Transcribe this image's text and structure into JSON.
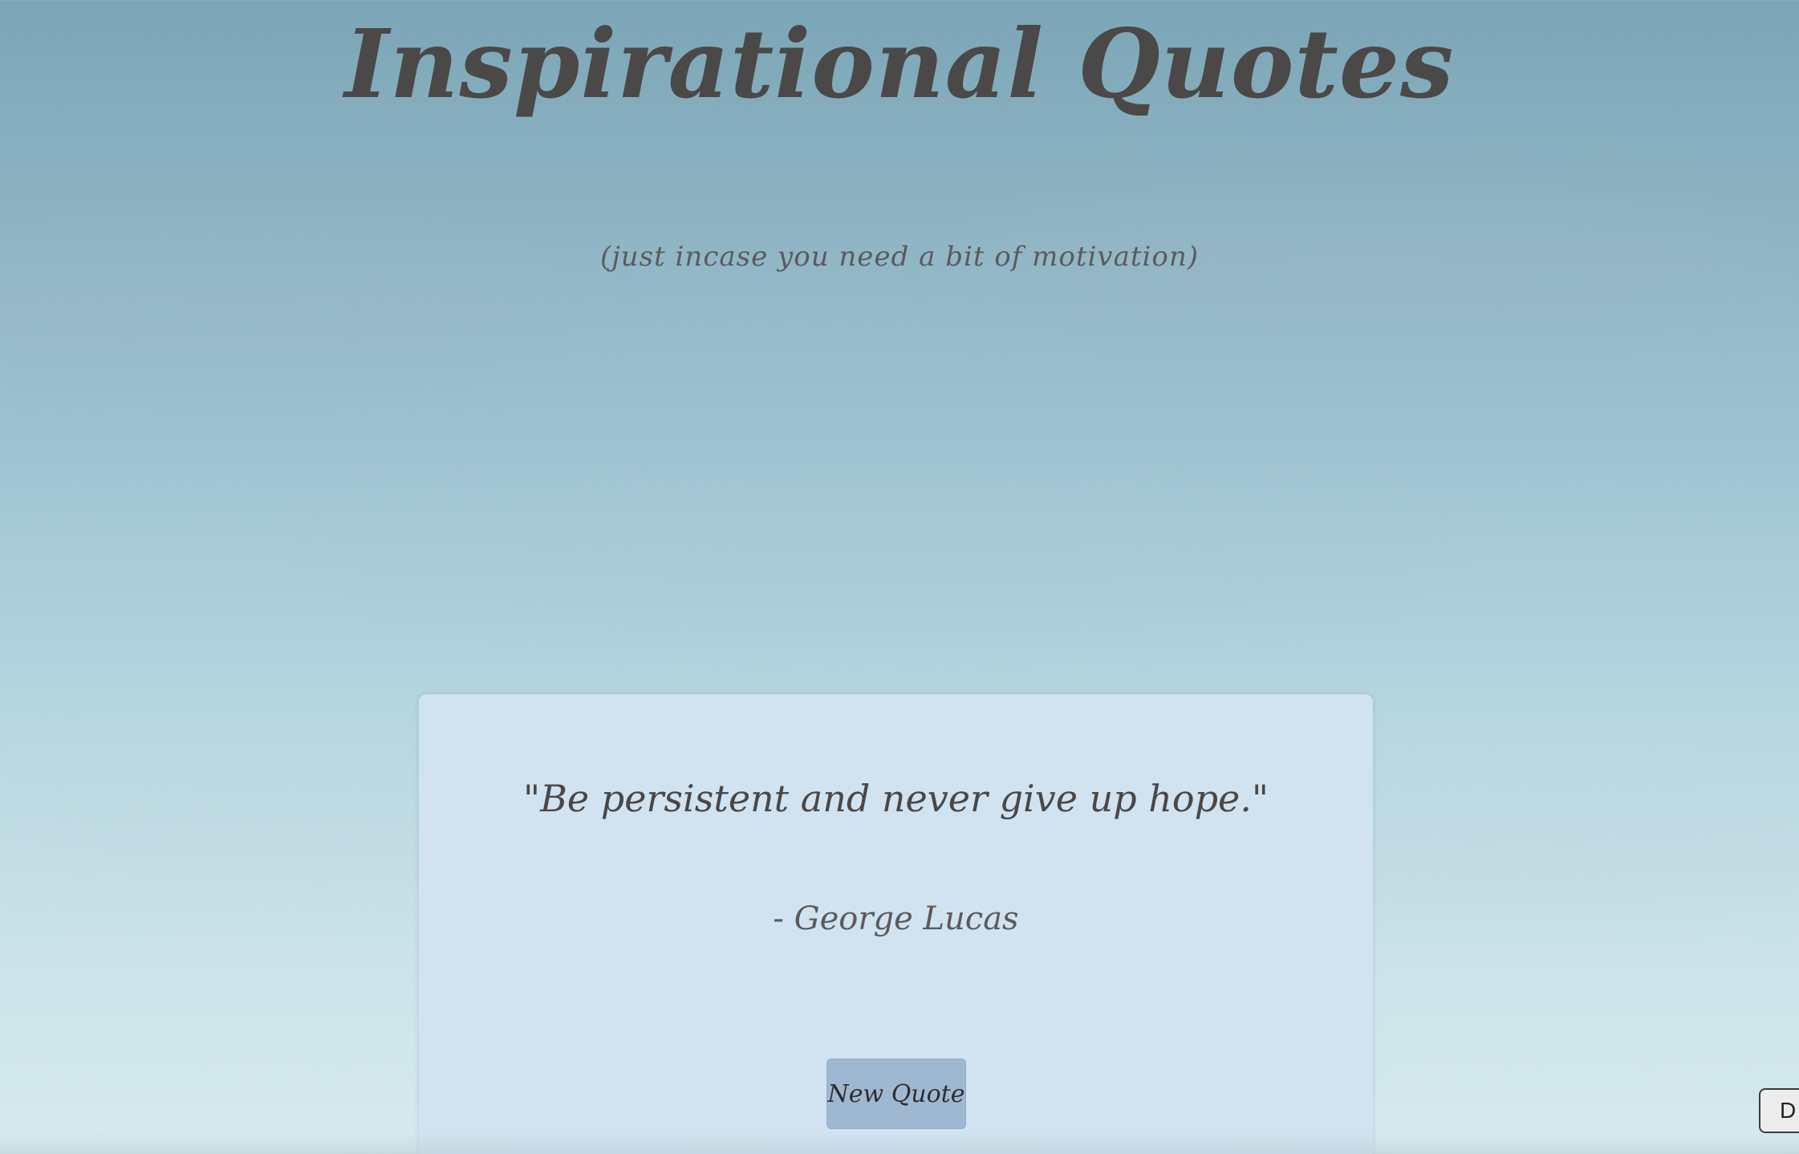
{
  "header": {
    "title": "Inspirational Quotes",
    "subtitle": "(just incase you need a bit of motivation)"
  },
  "quote_card": {
    "quote": "\"Be persistent and never give up hope.\"",
    "author": "- George Lucas",
    "button_label": "New Quote"
  },
  "corner_widget": {
    "label": "D"
  },
  "colors": {
    "sky_top": "#7ba6b7",
    "sky_bottom": "#d7eaee",
    "card_background": "#d1e3f0",
    "button_background": "#9fb8d2",
    "text": "#4b4848"
  }
}
